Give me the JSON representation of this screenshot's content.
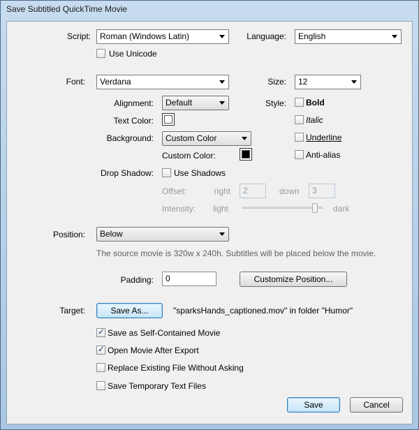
{
  "window": {
    "title": "Save Subtitled QuickTime Movie"
  },
  "script": {
    "label": "Script:",
    "value": "Roman (Windows Latin)"
  },
  "language": {
    "label": "Language:",
    "value": "English"
  },
  "use_unicode": {
    "label": "Use Unicode",
    "checked": false
  },
  "font": {
    "label": "Font:",
    "value": "Verdana"
  },
  "size": {
    "label": "Size:",
    "value": "12"
  },
  "alignment": {
    "label": "Alignment:",
    "value": "Default"
  },
  "style": {
    "label": "Style:",
    "bold": {
      "label": "Bold",
      "checked": false
    },
    "italic": {
      "label": "Italic",
      "checked": false
    },
    "underline": {
      "label": "Underline",
      "checked": false
    },
    "antialias": {
      "label": "Anti-alias",
      "checked": false
    }
  },
  "text_color": {
    "label": "Text Color:",
    "color": "#ffffff"
  },
  "background": {
    "label": "Background:",
    "value": "Custom Color"
  },
  "custom_color": {
    "label": "Custom Color:",
    "color": "#000000"
  },
  "drop_shadow": {
    "label": "Drop Shadow:",
    "use_shadows": {
      "label": "Use Shadows",
      "checked": false
    },
    "offset_label": "Offset:",
    "right_label": "right",
    "right_value": "2",
    "down_label": "down",
    "down_value": "3",
    "intensity_label": "Intensity:",
    "light_label": "light",
    "dark_label": "dark",
    "intensity_level": 0.93
  },
  "position": {
    "label": "Position:",
    "value": "Below",
    "note": "The source movie is 320w x 240h. Subtitles will be placed below the movie."
  },
  "padding": {
    "label": "Padding:",
    "value": "0"
  },
  "customize_position": {
    "label": "Customize Position..."
  },
  "target": {
    "label": "Target:",
    "save_as_label": "Save As...",
    "filename_text": "\"sparksHands_captioned.mov\" in folder \"Humor\""
  },
  "options": {
    "self_contained": {
      "label": "Save as Self-Contained Movie",
      "checked": true
    },
    "open_after": {
      "label": "Open Movie After Export",
      "checked": true
    },
    "replace_existing": {
      "label": "Replace Existing File Without Asking",
      "checked": false
    },
    "save_temp": {
      "label": "Save Temporary Text Files",
      "checked": false
    }
  },
  "footer": {
    "save_label": "Save",
    "cancel_label": "Cancel"
  },
  "colors": {
    "accent": "#3c7fb1",
    "disabled_text": "#9a9a9a"
  }
}
